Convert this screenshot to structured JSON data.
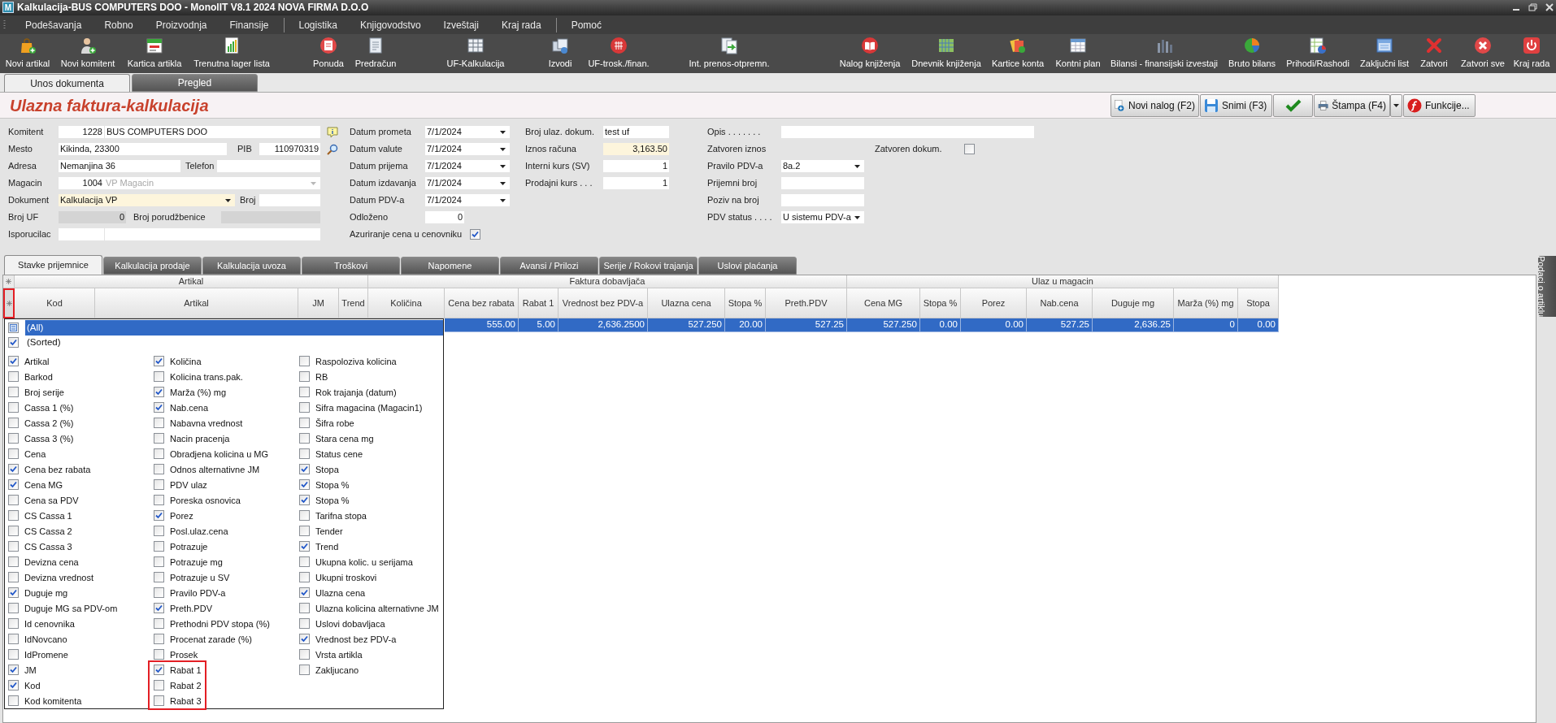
{
  "window": {
    "logo": "M",
    "title": "Kalkulacija-BUS COMPUTERS DOO - MonolIT V8.1 2024 NOVA FIRMA D.O.O"
  },
  "menu": [
    [
      "Podešavanja",
      "Robno",
      "Proizvodnja",
      "Finansije"
    ],
    [
      "Logistika",
      "Knjigovodstvo",
      "Izveštaji",
      "Kraj rada"
    ],
    [
      "Pomoć"
    ]
  ],
  "toolbar": [
    "Novi artikal",
    "Novi komitent",
    "Kartica artikla",
    "Trenutna lager lista",
    "Ponuda",
    "Predračun",
    "UF-Kalkulacija",
    "Izvodi",
    "UF-trosk./finan.",
    "Int. prenos-otpremn.",
    "Nalog knjiženja",
    "Dnevnik knjiženja",
    "Kartice konta",
    "Kontni plan",
    "Bilansi - finansijski izvestaji",
    "Bruto bilans",
    "Prihodi/Rashodi",
    "Zaključni list",
    "Zatvori",
    "Zatvori sve",
    "Kraj rada"
  ],
  "doc_tabs": [
    {
      "label": "Unos dokumenta",
      "selected": true
    },
    {
      "label": "Pregled",
      "selected": false
    }
  ],
  "header": {
    "title": "Ulazna faktura-kalkulacija",
    "buttons": [
      {
        "kind": "new",
        "label": "Novi nalog (F2)"
      },
      {
        "kind": "save",
        "label": "Snimi (F3)"
      },
      {
        "kind": "confirm"
      },
      {
        "kind": "print",
        "label": "Štampa (F4)"
      },
      {
        "kind": "functions",
        "label": "Funkcije..."
      }
    ]
  },
  "form": {
    "col1": [
      {
        "kind": "code-name",
        "label": "Komitent",
        "code": "1228",
        "value": "BUS COMPUTERS DOO"
      },
      {
        "kind": "pair",
        "label": "Mesto",
        "value": "Kikinda, 23300",
        "side_label": "PIB",
        "side_value": "110970319",
        "disabled": false
      },
      {
        "kind": "pair",
        "label": "Adresa",
        "value": "Nemanjina 36",
        "side_label": "Telefon",
        "disabled": false
      },
      {
        "kind": "code-combo",
        "label": "Magacin",
        "code": "1004",
        "value": "VP Magacin",
        "disabled": true
      },
      {
        "kind": "combo-pair",
        "label": "Dokument",
        "value": "Kalkulacija VP",
        "side_label": "Broj",
        "highlighted": true
      },
      {
        "kind": "number-pair",
        "label": "Broj UF",
        "value": "0",
        "side_label": "Broj porudžbenice",
        "disabled": true
      },
      {
        "kind": "code-name",
        "label": "Isporucilac"
      }
    ],
    "col2": [
      {
        "kind": "date",
        "label": "Datum prometa",
        "value": "7/1/2024"
      },
      {
        "kind": "date",
        "label": "Datum valute",
        "value": "7/1/2024"
      },
      {
        "kind": "date",
        "label": "Datum prijema",
        "value": "7/1/2024"
      },
      {
        "kind": "date",
        "label": "Datum izdavanja",
        "value": "7/1/2024"
      },
      {
        "kind": "date",
        "label": "Datum PDV-a",
        "value": "7/1/2024"
      },
      {
        "kind": "number",
        "label": "Odloženo",
        "value": "0"
      },
      {
        "kind": "check",
        "label": "Azuriranje cena u cenovniku",
        "checked": true
      }
    ],
    "col3": [
      {
        "kind": "text",
        "label": "Broj ulaz. dokum.",
        "value": "test uf",
        "highlighted": false
      },
      {
        "kind": "number",
        "label": "Iznos računa",
        "value": "3,163.50",
        "highlighted": true
      },
      {
        "kind": "number",
        "label": "Interni kurs (SV)",
        "value": "1",
        "highlighted": false
      },
      {
        "kind": "number",
        "label": "Prodajni kurs . . .",
        "value": "1",
        "highlighted": false
      }
    ],
    "col4": [
      {
        "kind": "wide-text",
        "label": "Opis . . . . . . ."
      },
      {
        "kind": "label-check",
        "label": "Zatvoren iznos",
        "check_label": "Zatvoren dokum.",
        "checked": false
      },
      {
        "kind": "combo",
        "label": "Pravilo PDV-a",
        "value": "8a.2"
      },
      {
        "kind": "text",
        "label": "Prijemni broj"
      },
      {
        "kind": "text",
        "label": "Poziv na broj"
      },
      {
        "kind": "combo",
        "label": "PDV status . . . .",
        "value": "U sistemu PDV-a"
      }
    ]
  },
  "item_tabs": [
    {
      "label": "Stavke prijemnice",
      "selected": true
    },
    {
      "label": "Kalkulacija prodaje",
      "selected": false
    },
    {
      "label": "Kalkulacija uvoza",
      "selected": false
    },
    {
      "label": "Troškovi",
      "selected": false
    },
    {
      "label": "Napomene",
      "selected": false
    },
    {
      "label": "Avansi / Prilozi",
      "selected": false
    },
    {
      "label": "Serije / Rokovi trajanja",
      "selected": false
    },
    {
      "label": "Uslovi plaćanja",
      "selected": false
    }
  ],
  "side_tab": {
    "label": "Podaci o artiklu"
  },
  "grid": {
    "marker_highlighted": true,
    "groups": [
      {
        "label": "Artikal",
        "columns": [
          "Kod",
          "Artikal",
          "JM",
          "Trend"
        ]
      },
      {
        "label": "Faktura dobavljača",
        "columns": [
          "Količina",
          "Cena bez rabata",
          "Rabat 1",
          "Vrednost bez PDV-a",
          "Ulazna cena",
          "Stopa %",
          "Preth.PDV"
        ]
      },
      {
        "label": "Ulaz u magacin",
        "columns": [
          "Cena MG",
          "Stopa %",
          "Porez",
          "Nab.cena",
          "Duguje mg",
          "Marža (%) mg",
          "Stopa"
        ]
      }
    ],
    "rows": [
      {
        "selected": true,
        "cells": [
          "555.00",
          "5.00",
          "2,636.2500",
          "527.250",
          "20.00",
          "527.25",
          "527.250",
          "0.00",
          "0.00",
          "527.25",
          "2,636.25",
          "0",
          "0.00"
        ]
      }
    ]
  },
  "column_chooser": {
    "all": {
      "label": "(All)",
      "mixed": true,
      "selected": true
    },
    "sorted": {
      "label": "(Sorted)",
      "checked": true
    },
    "columns": [
      [
        {
          "label": "Artikal",
          "checked": true,
          "highlighted": false
        },
        {
          "label": "Barkod",
          "checked": false,
          "highlighted": false
        },
        {
          "label": "Broj serije",
          "checked": false,
          "highlighted": false
        },
        {
          "label": "Cassa 1 (%)",
          "checked": false,
          "highlighted": false
        },
        {
          "label": "Cassa 2 (%)",
          "checked": false,
          "highlighted": false
        },
        {
          "label": "Cassa 3 (%)",
          "checked": false,
          "highlighted": false
        },
        {
          "label": "Cena",
          "checked": false,
          "highlighted": false
        },
        {
          "label": "Cena bez rabata",
          "checked": true,
          "highlighted": false
        },
        {
          "label": "Cena MG",
          "checked": true,
          "highlighted": false
        },
        {
          "label": "Cena sa PDV",
          "checked": false,
          "highlighted": false
        },
        {
          "label": "CS Cassa 1",
          "checked": false,
          "highlighted": false
        },
        {
          "label": "CS Cassa 2",
          "checked": false,
          "highlighted": false
        },
        {
          "label": "CS Cassa 3",
          "checked": false,
          "highlighted": false
        },
        {
          "label": "Devizna cena",
          "checked": false,
          "highlighted": false
        },
        {
          "label": "Devizna vrednost",
          "checked": false,
          "highlighted": false
        },
        {
          "label": "Duguje mg",
          "checked": true,
          "highlighted": false
        },
        {
          "label": "Duguje MG sa PDV-om",
          "checked": false,
          "highlighted": false
        },
        {
          "label": "Id cenovnika",
          "checked": false,
          "highlighted": false
        },
        {
          "label": "IdNovcano",
          "checked": false,
          "highlighted": false
        },
        {
          "label": "IdPromene",
          "checked": false,
          "highlighted": false
        },
        {
          "label": "JM",
          "checked": true,
          "highlighted": false
        },
        {
          "label": "Kod",
          "checked": true,
          "highlighted": false
        },
        {
          "label": "Kod komitenta",
          "checked": false,
          "highlighted": false
        }
      ],
      [
        {
          "label": "Količina",
          "checked": true,
          "highlighted": false
        },
        {
          "label": "Kolicina trans.pak.",
          "checked": false,
          "highlighted": false
        },
        {
          "label": "Marža (%) mg",
          "checked": true,
          "highlighted": false
        },
        {
          "label": "Nab.cena",
          "checked": true,
          "highlighted": false
        },
        {
          "label": "Nabavna vrednost",
          "checked": false,
          "highlighted": false
        },
        {
          "label": "Nacin pracenja",
          "checked": false,
          "highlighted": false
        },
        {
          "label": "Obradjena kolicina u MG",
          "checked": false,
          "highlighted": false
        },
        {
          "label": "Odnos alternativne JM",
          "checked": false,
          "highlighted": false
        },
        {
          "label": "PDV ulaz",
          "checked": false,
          "highlighted": false
        },
        {
          "label": "Poreska osnovica",
          "checked": false,
          "highlighted": false
        },
        {
          "label": "Porez",
          "checked": true,
          "highlighted": false
        },
        {
          "label": "Posl.ulaz.cena",
          "checked": false,
          "highlighted": false
        },
        {
          "label": "Potrazuje",
          "checked": false,
          "highlighted": false
        },
        {
          "label": "Potrazuje mg",
          "checked": false,
          "highlighted": false
        },
        {
          "label": "Potrazuje u SV",
          "checked": false,
          "highlighted": false
        },
        {
          "label": "Pravilo PDV-a",
          "checked": false,
          "highlighted": false
        },
        {
          "label": "Preth.PDV",
          "checked": true,
          "highlighted": false
        },
        {
          "label": "Prethodni PDV stopa (%)",
          "checked": false,
          "highlighted": false
        },
        {
          "label": "Procenat zarade (%)",
          "checked": false,
          "highlighted": false
        },
        {
          "label": "Prosek",
          "checked": false,
          "highlighted": false
        },
        {
          "label": "Rabat 1",
          "checked": true,
          "highlighted": true
        },
        {
          "label": "Rabat 2",
          "checked": false,
          "highlighted": true
        },
        {
          "label": "Rabat 3",
          "checked": false,
          "highlighted": true
        }
      ],
      [
        {
          "label": "Raspoloziva kolicina",
          "checked": false,
          "highlighted": false
        },
        {
          "label": "RB",
          "checked": false,
          "highlighted": false
        },
        {
          "label": "Rok trajanja (datum)",
          "checked": false,
          "highlighted": false
        },
        {
          "label": "Sifra magacina (Magacin1)",
          "checked": false,
          "highlighted": false
        },
        {
          "label": "Šifra robe",
          "checked": false,
          "highlighted": false
        },
        {
          "label": "Stara cena mg",
          "checked": false,
          "highlighted": false
        },
        {
          "label": "Status cene",
          "checked": false,
          "highlighted": false
        },
        {
          "label": "Stopa",
          "checked": true,
          "highlighted": false
        },
        {
          "label": "Stopa %",
          "checked": true,
          "highlighted": false
        },
        {
          "label": "Stopa %",
          "checked": true,
          "highlighted": false
        },
        {
          "label": "Tarifna stopa",
          "checked": false,
          "highlighted": false
        },
        {
          "label": "Tender",
          "checked": false,
          "highlighted": false
        },
        {
          "label": "Trend",
          "checked": true,
          "highlighted": false
        },
        {
          "label": "Ukupna kolic. u serijama",
          "checked": false,
          "highlighted": false
        },
        {
          "label": "Ukupni troskovi",
          "checked": false,
          "highlighted": false
        },
        {
          "label": "Ulazna cena",
          "checked": true,
          "highlighted": false
        },
        {
          "label": "Ulazna kolicina alternativne JM",
          "checked": false,
          "highlighted": false
        },
        {
          "label": "Uslovi dobavljaca",
          "checked": false,
          "highlighted": false
        },
        {
          "label": "Vrednost bez PDV-a",
          "checked": true,
          "highlighted": false
        },
        {
          "label": "Vrsta artikla",
          "checked": false,
          "highlighted": false
        },
        {
          "label": "Zakljucano",
          "checked": false,
          "highlighted": false
        }
      ]
    ]
  }
}
